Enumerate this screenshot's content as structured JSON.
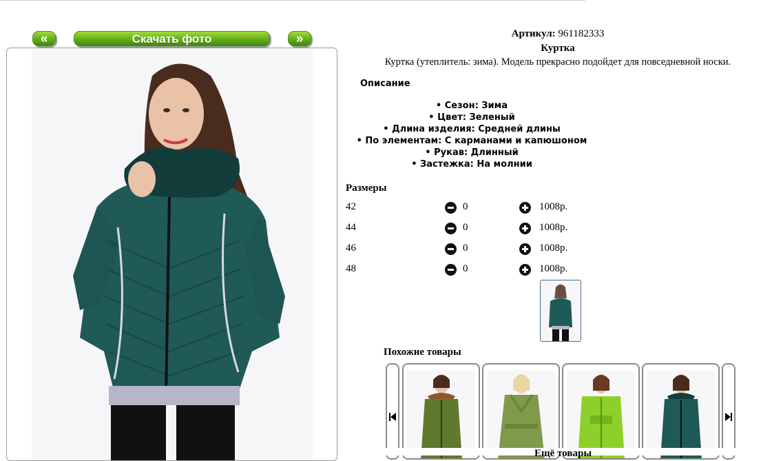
{
  "nav": {
    "prev_label": "«",
    "next_label": "»",
    "download_label": "Скачать фото"
  },
  "product": {
    "article_label": "Артикул:",
    "article_value": "961182333",
    "title": "Куртка",
    "description": "Куртка (утеплитель: зима). Модель прекрасно подойдет для повседневной носки.",
    "description_heading": "Описание",
    "attributes": [
      "• Сезон: Зима",
      "• Цвет: Зеленый",
      "• Длина изделия: Средней длины",
      "• По элементам: С карманами и капюшоном",
      "• Рукав: Длинный",
      "• Застежка: На молнии"
    ],
    "colors": {
      "jacket": "#1f5a57",
      "accent_green": "#6fb51e"
    }
  },
  "sizes": {
    "heading": "Размеры",
    "rows": [
      {
        "size": "42",
        "qty": "0",
        "price": "1008р."
      },
      {
        "size": "44",
        "qty": "0",
        "price": "1008р."
      },
      {
        "size": "46",
        "qty": "0",
        "price": "1008р."
      },
      {
        "size": "48",
        "qty": "0",
        "price": "1008р."
      }
    ]
  },
  "similar": {
    "heading": "Похожие товары",
    "items": [
      {
        "color": "#5f7a2c"
      },
      {
        "color": "#7f9a4a"
      },
      {
        "color": "#8ed02a"
      },
      {
        "color": "#1f5a57"
      }
    ]
  },
  "bottom_text": "Ещё товары"
}
